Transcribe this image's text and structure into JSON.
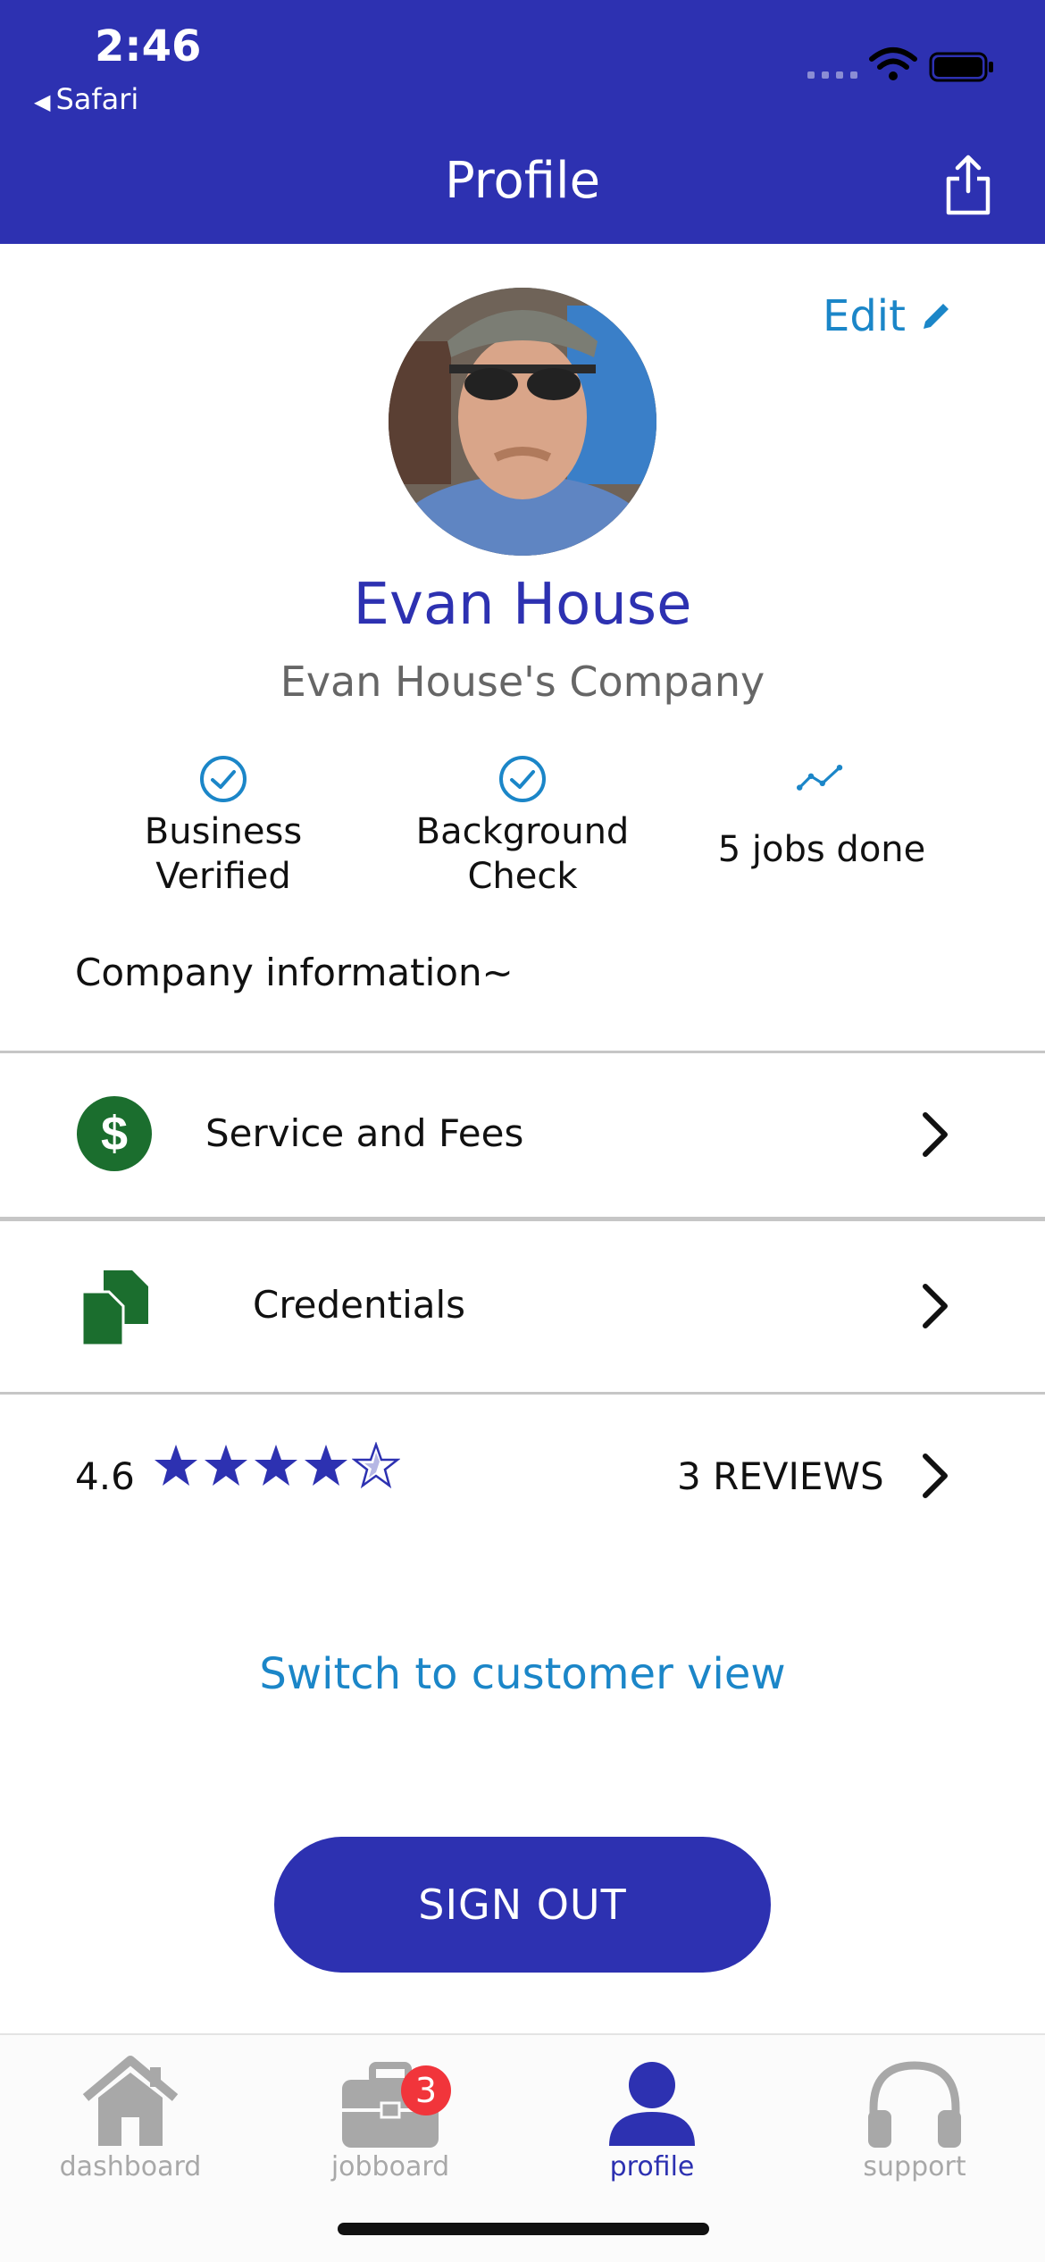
{
  "status_bar": {
    "time": "2:46",
    "back_app": "Safari"
  },
  "header": {
    "title": "Profile"
  },
  "profile": {
    "edit_label": "Edit",
    "name": "Evan House",
    "company": "Evan House's Company",
    "badges": [
      {
        "label_line1": "Business",
        "label_line2": "Verified"
      },
      {
        "label_line1": "Background",
        "label_line2": "Check"
      },
      {
        "label": "5 jobs done"
      }
    ],
    "company_info": "Company information~"
  },
  "rows": {
    "service_fees": "Service and Fees",
    "credentials": "Credentials"
  },
  "rating": {
    "value": "4.6",
    "stars_filled": 4,
    "stars_total": 5,
    "reviews_label": "3 REVIEWS"
  },
  "switch_view": "Switch to customer view",
  "sign_out": "SIGN OUT",
  "tabbar": {
    "tabs": [
      {
        "label": "dashboard",
        "icon": "home-icon"
      },
      {
        "label": "jobboard",
        "icon": "briefcase-icon",
        "badge": "3"
      },
      {
        "label": "profile",
        "icon": "person-icon",
        "active": true
      },
      {
        "label": "support",
        "icon": "headphones-icon"
      }
    ]
  },
  "colors": {
    "primary": "#2d31b1",
    "link": "#1b86c8",
    "green": "#1b6e2e",
    "badge_red": "#f1353b"
  }
}
